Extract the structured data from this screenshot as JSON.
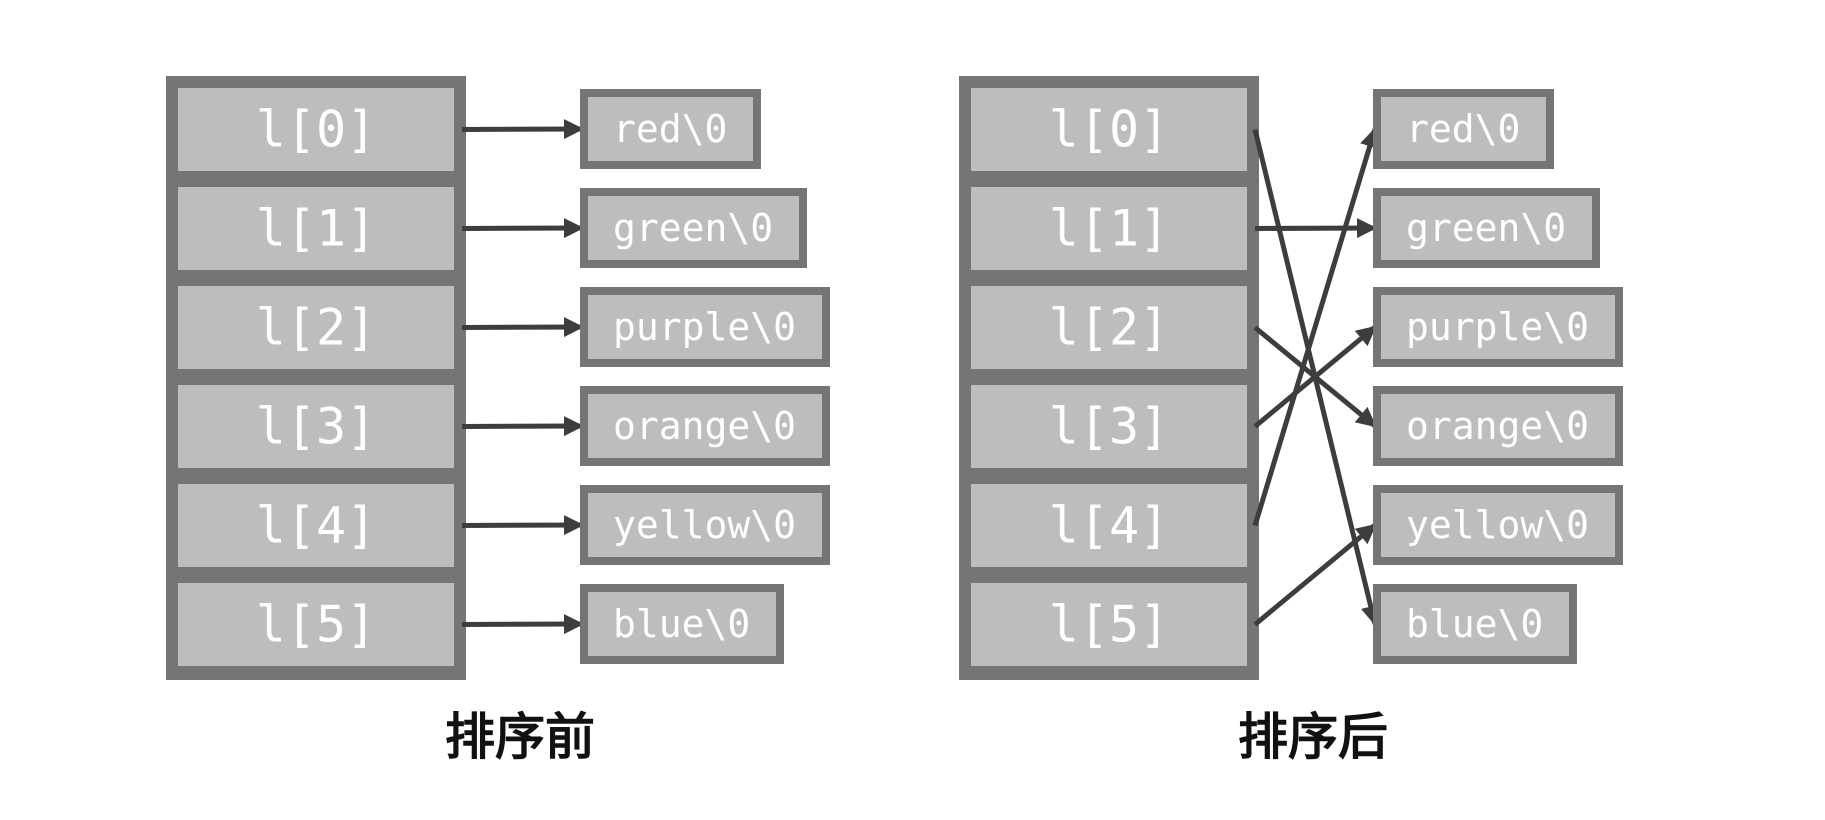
{
  "colors": {
    "cell_fill": "#bdbdbd",
    "cell_border": "#757575",
    "arrow": "#3d3d3d",
    "text": "#ffffff",
    "caption": "#111111"
  },
  "panels": [
    {
      "caption": "排序前",
      "slots": [
        "l[0]",
        "l[1]",
        "l[2]",
        "l[3]",
        "l[4]",
        "l[5]"
      ],
      "strings": [
        "red\\0",
        "green\\0",
        "purple\\0",
        "orange\\0",
        "yellow\\0",
        "blue\\0"
      ],
      "links": [
        0,
        1,
        2,
        3,
        4,
        5
      ]
    },
    {
      "caption": "排序后",
      "slots": [
        "l[0]",
        "l[1]",
        "l[2]",
        "l[3]",
        "l[4]",
        "l[5]"
      ],
      "strings": [
        "red\\0",
        "green\\0",
        "purple\\0",
        "orange\\0",
        "yellow\\0",
        "blue\\0"
      ],
      "links": [
        5,
        1,
        3,
        2,
        0,
        4
      ]
    }
  ]
}
